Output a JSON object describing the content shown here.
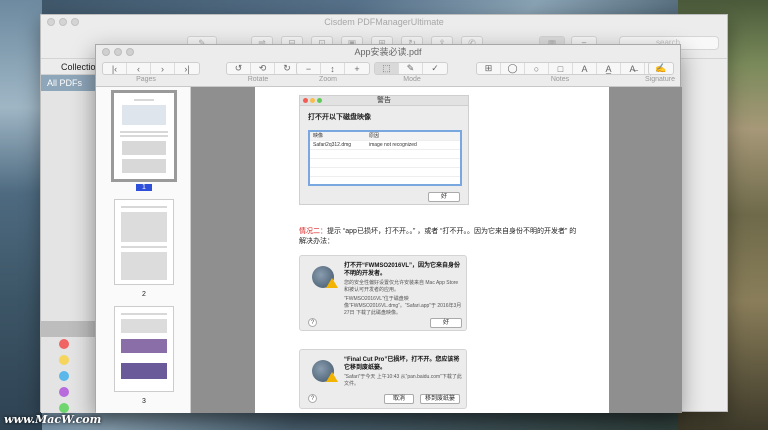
{
  "back_window": {
    "title": "Cisdem PDFManagerUltimate",
    "search_placeholder": "search",
    "collections_label": "Collection",
    "all_pdfs_label": "All PDFs",
    "tag_colors": [
      "#f06464",
      "#f5d55c",
      "#5ab7ea",
      "#b86bdc",
      "#6fd66f"
    ]
  },
  "front_window": {
    "title": "App安装必读.pdf",
    "toolbar_groups": {
      "pages": "Pages",
      "rotate": "Rotate",
      "zoom": "Zoom",
      "mode": "Mode",
      "notes": "Notes",
      "signature": "Signature"
    },
    "thumbnails": [
      {
        "page": "1",
        "selected": true
      },
      {
        "page": "2",
        "selected": false
      },
      {
        "page": "3",
        "selected": false
      }
    ]
  },
  "document": {
    "alert1": {
      "window_title": "警告",
      "heading": "打不开以下磁盘映像",
      "col_image": "映像",
      "col_reason": "原因",
      "row_image": "Safari2q312.dmg",
      "row_reason": "image not recognized",
      "ok": "好"
    },
    "note": {
      "label": "情况二：",
      "text": "提示 “app已损坏，打不开。。” ，或者 “打不开。。因为它来自身份不明的开发者” 的解决办法："
    },
    "alert2": {
      "title": "打不开“FWMSO2016VL”，因为它来自身份不明的开发者。",
      "body1": "您的安全性偏好设置仅允许安装来自 Mac App Store 和被认可开发者的应用。",
      "body2": "“FWMSO2016VL”位于磁盘映像“FWMSO2016VL.dmg”。“Safari.app”于 2016年3月27日 下载了此磁盘映像。",
      "help": "?",
      "ok": "好"
    },
    "alert3": {
      "title": "“Final Cut Pro”已损坏，打不开。您应该将它移到废纸篓。",
      "body": "“Safari”于今天 上午10:43 从“pan.baidu.com”下载了此文件。",
      "help": "?",
      "cancel": "取消",
      "trash": "移到废纸篓"
    }
  },
  "watermark": "www.MacW.com"
}
